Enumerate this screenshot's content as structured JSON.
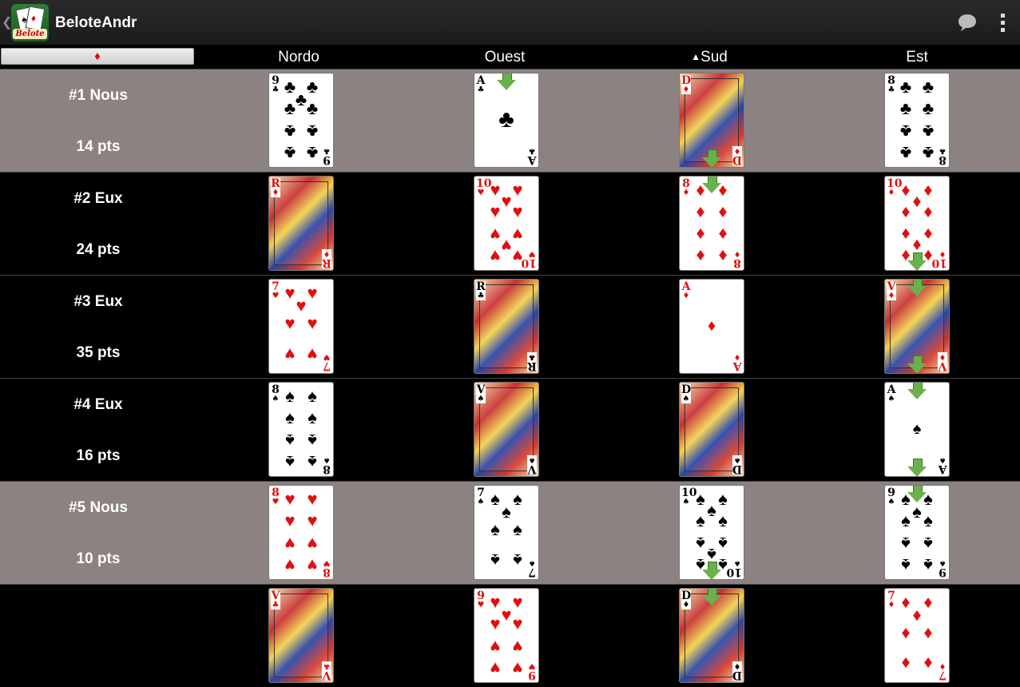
{
  "app": {
    "title": "BeloteAndr",
    "icon_banner": "Belote",
    "back_icon": "chevron-left-icon",
    "chat_icon": "speech-bubble-icon",
    "menu_icon": "overflow-menu-icon"
  },
  "header": {
    "trump_suit": "♦",
    "trump_color": "#e00000",
    "columns": [
      "Nordo",
      "Ouest",
      "Sud",
      "Est"
    ],
    "dealer_marker": "▲",
    "dealer_column": 2
  },
  "rows": [
    {
      "label": "#1  Nous",
      "points": "14 pts",
      "team": "nous",
      "cards": [
        {
          "rank": "9",
          "suit": "♣",
          "color": "black",
          "arrow": null
        },
        {
          "rank": "A",
          "suit": "♣",
          "color": "black",
          "arrow": "top"
        },
        {
          "rank": "D",
          "suit": "♦",
          "color": "red",
          "arrow": "bot"
        },
        {
          "rank": "8",
          "suit": "♣",
          "color": "black",
          "arrow": null
        }
      ]
    },
    {
      "label": "#2  Eux",
      "points": "24 pts",
      "team": "eux",
      "cards": [
        {
          "rank": "R",
          "suit": "♦",
          "color": "red",
          "arrow": null
        },
        {
          "rank": "10",
          "suit": "♥",
          "color": "red",
          "arrow": null
        },
        {
          "rank": "8",
          "suit": "♦",
          "color": "red",
          "arrow": "top"
        },
        {
          "rank": "10",
          "suit": "♦",
          "color": "red",
          "arrow": "bot"
        }
      ]
    },
    {
      "label": "#3  Eux",
      "points": "35 pts",
      "team": "eux",
      "cards": [
        {
          "rank": "7",
          "suit": "♥",
          "color": "red",
          "arrow": null
        },
        {
          "rank": "R",
          "suit": "♣",
          "color": "black",
          "arrow": null
        },
        {
          "rank": "A",
          "suit": "♦",
          "color": "red",
          "arrow": null
        },
        {
          "rank": "V",
          "suit": "♦",
          "color": "red",
          "arrow": "both"
        }
      ]
    },
    {
      "label": "#4  Eux",
      "points": "16 pts",
      "team": "eux",
      "cards": [
        {
          "rank": "8",
          "suit": "♠",
          "color": "black",
          "arrow": null
        },
        {
          "rank": "V",
          "suit": "♠",
          "color": "black",
          "arrow": null
        },
        {
          "rank": "D",
          "suit": "♠",
          "color": "black",
          "arrow": null
        },
        {
          "rank": "A",
          "suit": "♠",
          "color": "black",
          "arrow": "both"
        }
      ]
    },
    {
      "label": "#5  Nous",
      "points": "10 pts",
      "team": "nous",
      "cards": [
        {
          "rank": "8",
          "suit": "♥",
          "color": "red",
          "arrow": null
        },
        {
          "rank": "7",
          "suit": "♠",
          "color": "black",
          "arrow": null
        },
        {
          "rank": "10",
          "suit": "♠",
          "color": "black",
          "arrow": "bot"
        },
        {
          "rank": "9",
          "suit": "♠",
          "color": "black",
          "arrow": "top"
        }
      ]
    },
    {
      "label": "",
      "points": "",
      "team": "eux",
      "cards": [
        {
          "rank": "V",
          "suit": "♣",
          "color": "red",
          "arrow": null
        },
        {
          "rank": "9",
          "suit": "♥",
          "color": "red",
          "arrow": null
        },
        {
          "rank": "D",
          "suit": "♦",
          "color": "black",
          "arrow": "top"
        },
        {
          "rank": "7",
          "suit": "♦",
          "color": "red",
          "arrow": null
        }
      ]
    }
  ]
}
